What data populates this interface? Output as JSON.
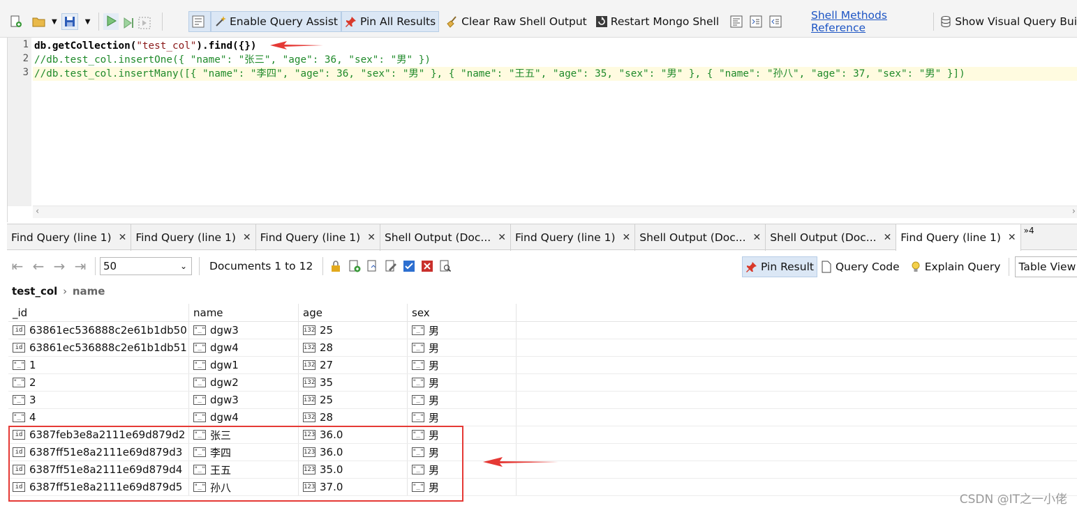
{
  "toolbar": {
    "enable_query_assist": "Enable Query Assist",
    "pin_all_results": "Pin All Results",
    "clear_raw_shell_output": "Clear Raw Shell Output",
    "restart_mongo_shell": "Restart Mongo Shell",
    "shell_methods_reference": "Shell Methods Reference",
    "show_visual_query_builder": "Show Visual Query Bui"
  },
  "editor": {
    "line_numbers": [
      "1",
      "2",
      "3"
    ],
    "line1": {
      "a": "db.getCollection(",
      "b": "\"test_col\"",
      "c": ").find({})"
    },
    "line2": "//db.test_col.insertOne({ \"name\": \"张三\", \"age\": 36, \"sex\": \"男\" })",
    "line3": "//db.test_col.insertMany([{ \"name\": \"李四\", \"age\": 36, \"sex\": \"男\" }, { \"name\": \"王五\", \"age\": 35, \"sex\": \"男\" }, { \"name\": \"孙八\", \"age\": 37, \"sex\": \"男\" }])"
  },
  "tabs": [
    {
      "label": "Find Query (line 1)"
    },
    {
      "label": "Find Query (line 1)"
    },
    {
      "label": "Find Query (line 1)"
    },
    {
      "label": "Shell Output (Doc..."
    },
    {
      "label": "Find Query (line 1)"
    },
    {
      "label": "Shell Output (Doc..."
    },
    {
      "label": "Shell Output (Doc..."
    },
    {
      "label": "Find Query (line 1)"
    }
  ],
  "tabs_overflow": "»4",
  "results": {
    "page_size": "50",
    "documents_label": "Documents 1 to 12",
    "pin_result": "Pin Result",
    "query_code": "Query Code",
    "explain_query": "Explain Query",
    "view_mode": "Table View"
  },
  "breadcrumb": {
    "collection": "test_col",
    "field": "name"
  },
  "table": {
    "columns": [
      "_id",
      "name",
      "age",
      "sex"
    ],
    "rows": [
      {
        "id": "63861ec536888c2e61b1db50",
        "id_type": "id",
        "name": "dgw3",
        "age": "25",
        "age_type": "i32",
        "sex": "男"
      },
      {
        "id": "63861ec536888c2e61b1db51",
        "id_type": "id",
        "name": "dgw4",
        "age": "28",
        "age_type": "i32",
        "sex": "男"
      },
      {
        "id": "1",
        "id_type": "str",
        "name": "dgw1",
        "age": "27",
        "age_type": "i32",
        "sex": "男"
      },
      {
        "id": "2",
        "id_type": "str",
        "name": "dgw2",
        "age": "35",
        "age_type": "i32",
        "sex": "男"
      },
      {
        "id": "3",
        "id_type": "str",
        "name": "dgw3",
        "age": "25",
        "age_type": "i32",
        "sex": "男"
      },
      {
        "id": "4",
        "id_type": "str",
        "name": "dgw4",
        "age": "28",
        "age_type": "i32",
        "sex": "男"
      },
      {
        "id": "6387feb3e8a2111e69d879d2",
        "id_type": "id",
        "name": "张三",
        "age": "36.0",
        "age_type": "123",
        "sex": "男"
      },
      {
        "id": "6387ff51e8a2111e69d879d3",
        "id_type": "id",
        "name": "李四",
        "age": "36.0",
        "age_type": "123",
        "sex": "男"
      },
      {
        "id": "6387ff51e8a2111e69d879d4",
        "id_type": "id",
        "name": "王五",
        "age": "35.0",
        "age_type": "123",
        "sex": "男"
      },
      {
        "id": "6387ff51e8a2111e69d879d5",
        "id_type": "id",
        "name": "孙八",
        "age": "37.0",
        "age_type": "123",
        "sex": "男"
      }
    ]
  },
  "watermark": "CSDN @IT之一小佬",
  "colors": {
    "accent": "#1d55c4",
    "annotation": "#e53935"
  }
}
